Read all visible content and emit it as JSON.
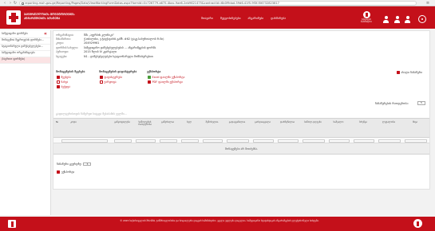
{
  "browser": {
    "url": "reporting.moh.gov.ge/Reporting/Pages/Data/ViewWorkingFormDatas.aspx?formId=0c726779-a675-4bac-9ae6-2eb9621475&contractId=6b0f9dad-59d6-41f5-9f3f-f06732823817"
  },
  "header": {
    "title_line1": "ᲯᲐᲜᲛᲠᲗᲔᲚᲝᲑᲘᲡ ᲛᲝᲜᲘᲢᲝᲠᲘᲜᲒᲘᲡ",
    "title_line2": "ᲐᲜᲒᲐᲠᲘᲨᲒᲔᲑᲘᲡ ᲡᲘᲡᲢᲔᲛᲐ",
    "nav": [
      "მთავარი",
      "შეტყობინებები",
      "ანგარიშები",
      "დახმარება"
    ],
    "badge_caption": "ჯანდაცვის სამინისტრო",
    "accent_color": "#c4101a"
  },
  "sidebar": {
    "items": [
      "სამედიცინო ფორმები",
      "მონაცემთა შეგროვების ფორმები...",
      "სტაციონარული დაწესებულებები...",
      "სამედიცინო ორგანიზაციები",
      "(საერთო ფორმები)"
    ],
    "active_index": 4
  },
  "info": {
    "rows": [
      {
        "k": "ორგანიზაცია:",
        "v": "შპს „ავერსის კლინიკა“"
      },
      {
        "k": "მისამართი:",
        "v": "ქ.თბილისი, ვ.ჭავჭავაძის გამზ. #62 (ვაკე-საბურთალოს რ-ნი)"
      },
      {
        "k": "კოდი:",
        "v": "204929961"
      },
      {
        "k": "ფორმის სახელი:",
        "v": "სამედიცინო დაწესებულებების ... ანგარიშგების ფორმა"
      },
      {
        "k": "პერიოდი:",
        "v": "2015 წლის IV კვარტალი"
      },
      {
        "k": "სტატუსი:",
        "v": "N1 - დაწესებულებები სტაციონარული მომსახურებით"
      }
    ]
  },
  "action_groups": [
    {
      "title": "მონაცემების შევსება",
      "items": [
        {
          "label": "შევსება",
          "icon": "edit-icon"
        },
        {
          "label": "ნახვა",
          "icon": "view-icon"
        },
        {
          "label": "ბეჭდვა",
          "icon": "print-icon"
        }
      ]
    },
    {
      "title": "მონაცემების დადასტურება",
      "items": [
        {
          "label": "დადასტურება",
          "icon": "approve-icon"
        },
        {
          "label": "უარყოფა",
          "icon": "reject-icon"
        }
      ]
    },
    {
      "title": "ექსპორტი",
      "items": [
        {
          "label": "Excel ფაილში ექსპორტი",
          "icon": "excel-icon"
        },
        {
          "label": "PDF ფაილში ექსპორტი",
          "icon": "pdf-icon"
        }
      ]
    }
  ],
  "add_button": "ახალი ჩანაწერი",
  "pager": {
    "label": "ჩანაწერების რაოდენობა:",
    "value": "5"
  },
  "filter_note": "გაფილტვრისთვის ჩაწერეთ სიტყვა შესაბამის ველში...",
  "grid": {
    "columns": [
      "№",
      "კოდი",
      "განყოფილება",
      "საწოლების რაოდენობა",
      "გაწერილია",
      "სულ",
      "შემოსულია",
      "გადაყვანილია",
      "გარდაიცვალა",
      "დარჩენილია",
      "საწოლ-დღეები",
      "საშუალო",
      "ბრუნვა",
      "ლეტალობა",
      "სხვა"
    ],
    "empty_text": "მონაცემები არ მოიძებნა."
  },
  "footer": {
    "page_size_label": "ჩანაწერი გვერდზე:",
    "page_size_value": "5",
    "export_label": "ექსპორტი",
    "copyright": "© 2015 საქართველოს შრომის, ჯანმრთელობისა და სოციალური დაცვის სამინისტრო. ყველა უფლება დაცულია. სამედიცინო სტატისტიკის ანგარიშგების ელექტრონული სისტემა."
  }
}
